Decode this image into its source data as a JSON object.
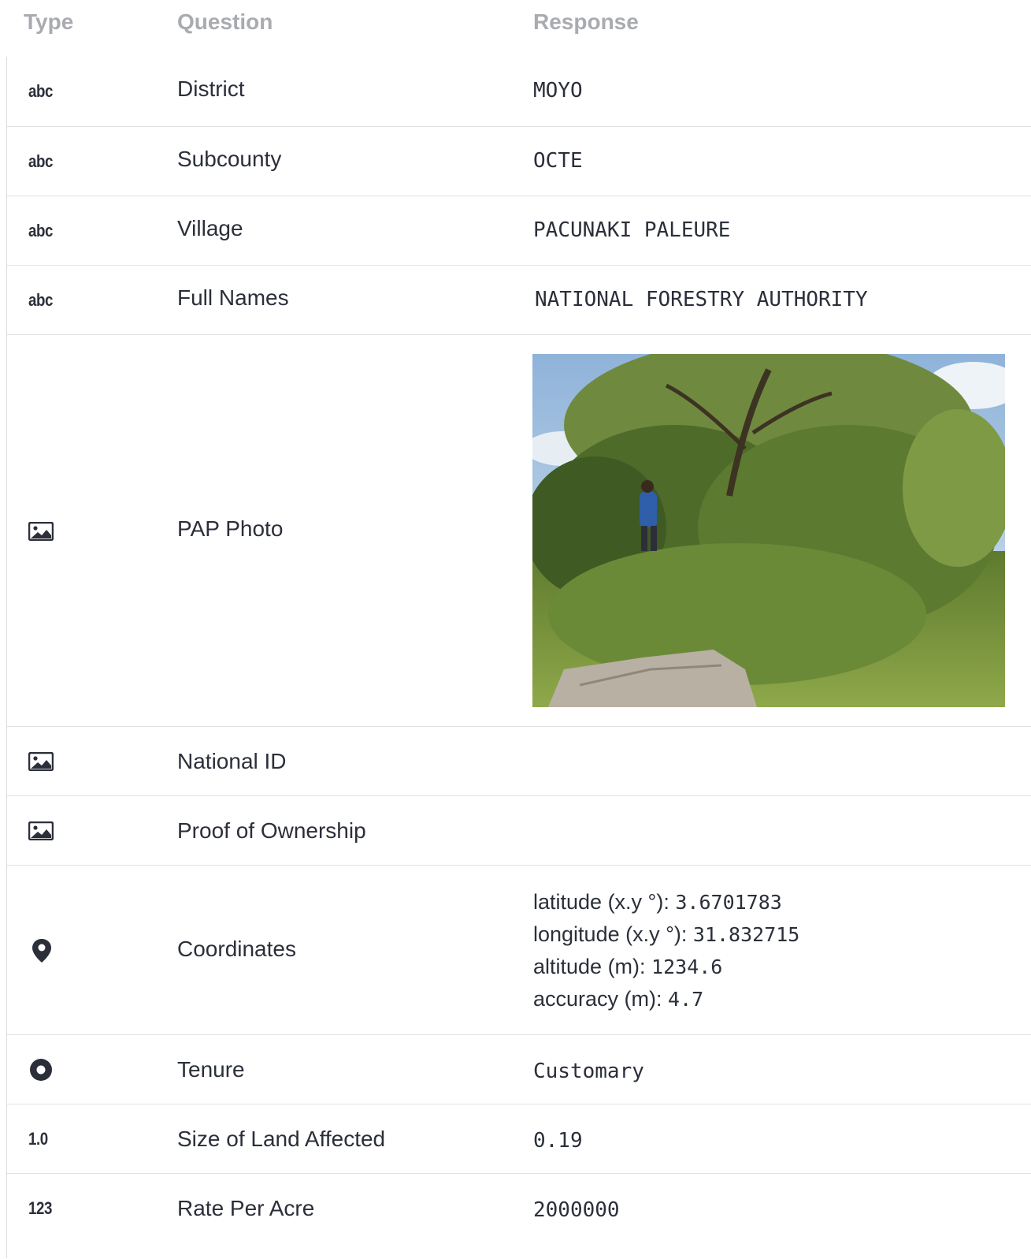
{
  "header": {
    "type": "Type",
    "question": "Question",
    "response": "Response"
  },
  "rows": [
    {
      "type_label": "abc",
      "question": "District",
      "response": "MOYO"
    },
    {
      "type_label": "abc",
      "question": "Subcounty",
      "response": "OCTE"
    },
    {
      "type_label": "abc",
      "question": "Village",
      "response": "PACUNAKI PALEURE"
    },
    {
      "type_label": "abc",
      "question": "Full Names",
      "response": "NATIONAL FORESTRY AUTHORITY"
    },
    {
      "type_icon": "image-icon",
      "question": "PAP Photo",
      "response_photo": "photo of a person among trees, shrubs and tall grass beside a large rock"
    },
    {
      "type_icon": "image-icon",
      "question": "National ID",
      "response": ""
    },
    {
      "type_icon": "image-icon",
      "question": "Proof of Ownership",
      "response": ""
    },
    {
      "type_icon": "map-pin-icon",
      "question": "Coordinates",
      "coords": [
        {
          "label": "latitude (x.y °): ",
          "value": "3.6701783"
        },
        {
          "label": "longitude (x.y °): ",
          "value": "31.832715"
        },
        {
          "label": "altitude (m): ",
          "value": "1234.6"
        },
        {
          "label": "accuracy (m): ",
          "value": "4.7"
        }
      ]
    },
    {
      "type_icon": "radio-icon",
      "question": "Tenure",
      "response": "Customary"
    },
    {
      "type_label": "1.0",
      "question": "Size of Land Affected",
      "response": "0.19"
    },
    {
      "type_label": "123",
      "question": "Rate Per Acre",
      "response": "2000000"
    }
  ]
}
